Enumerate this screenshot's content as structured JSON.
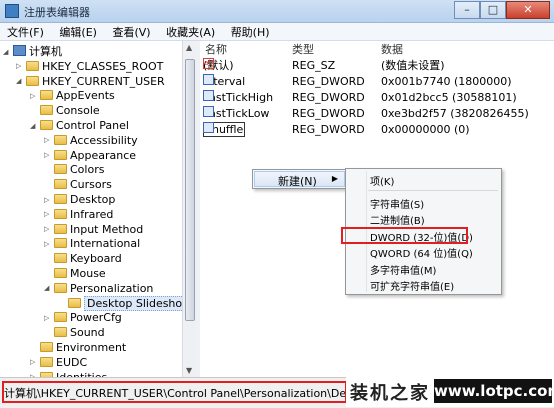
{
  "window": {
    "title": "注册表编辑器",
    "minimize": "–",
    "maximize": "□",
    "close": "✕"
  },
  "menu": [
    "文件(F)",
    "编辑(E)",
    "查看(V)",
    "收藏夹(A)",
    "帮助(H)"
  ],
  "tree": [
    {
      "label": "计算机",
      "exp": "◢",
      "kind": "pc"
    },
    {
      "label": "HKEY_CLASSES_ROOT",
      "exp": "▷"
    },
    {
      "label": "HKEY_CURRENT_USER",
      "exp": "◢"
    },
    {
      "label": "AppEvents",
      "exp": "▷"
    },
    {
      "label": "Console",
      "exp": ""
    },
    {
      "label": "Control Panel",
      "exp": "◢"
    },
    {
      "label": "Accessibility",
      "exp": "▷"
    },
    {
      "label": "Appearance",
      "exp": "▷"
    },
    {
      "label": "Colors",
      "exp": ""
    },
    {
      "label": "Cursors",
      "exp": ""
    },
    {
      "label": "Desktop",
      "exp": "▷"
    },
    {
      "label": "Infrared",
      "exp": "▷"
    },
    {
      "label": "Input Method",
      "exp": "▷"
    },
    {
      "label": "International",
      "exp": "▷"
    },
    {
      "label": "Keyboard",
      "exp": ""
    },
    {
      "label": "Mouse",
      "exp": ""
    },
    {
      "label": "Personalization",
      "exp": "◢"
    },
    {
      "label": "Desktop Slideshow",
      "exp": "",
      "selected": true
    },
    {
      "label": "PowerCfg",
      "exp": "▷"
    },
    {
      "label": "Sound",
      "exp": ""
    },
    {
      "label": "Environment",
      "exp": ""
    },
    {
      "label": "EUDC",
      "exp": "▷"
    },
    {
      "label": "Identities",
      "exp": "▷"
    }
  ],
  "columns": {
    "name": "名称",
    "type": "类型",
    "data": "数据"
  },
  "values": [
    {
      "name": "(默认)",
      "type": "REG_SZ",
      "data": "(数值未设置)",
      "icon": "ab"
    },
    {
      "name": "Interval",
      "type": "REG_DWORD",
      "data": "0x001b7740 (1800000)",
      "icon": "bin"
    },
    {
      "name": "LastTickHigh",
      "type": "REG_DWORD",
      "data": "0x01d2bcc5 (30588101)",
      "icon": "bin"
    },
    {
      "name": "LastTickLow",
      "type": "REG_DWORD",
      "data": "0xe3bd2f57 (3820826455)",
      "icon": "bin"
    },
    {
      "name": "Shuffle",
      "type": "REG_DWORD",
      "data": "0x00000000 (0)",
      "icon": "bin"
    }
  ],
  "context_menu": {
    "new_label": "新建(N)",
    "arrow": "▶"
  },
  "submenu": {
    "key": "项(K)",
    "string": "字符串值(S)",
    "binary": "二进制值(B)",
    "dword": "DWORD (32-位)值(D)",
    "qword": "QWORD (64 位)值(Q)",
    "multi": "多字符串值(M)",
    "expand": "可扩充字符串值(E)"
  },
  "status_path": "计算机\\HKEY_CURRENT_USER\\Control Panel\\Personalization\\Desktop Slideshow",
  "watermark": {
    "cn": "装机之家",
    "url": "www.lotpc.com"
  }
}
